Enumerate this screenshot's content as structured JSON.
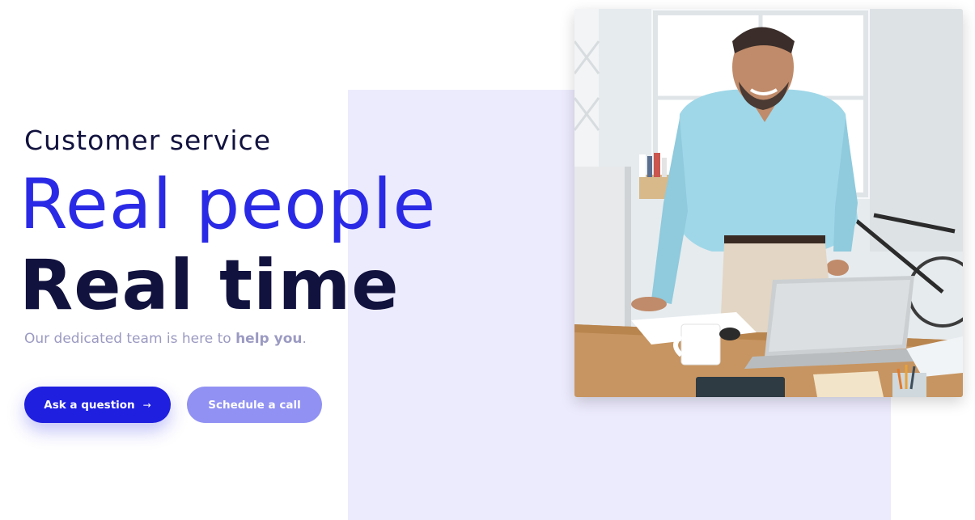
{
  "hero": {
    "eyebrow": "Customer service",
    "headline_line_1": "Real people",
    "headline_line_2": "Real time",
    "subtitle_prefix": "Our dedicated team is here to ",
    "subtitle_emphasis": "help you",
    "subtitle_suffix": "."
  },
  "buttons": {
    "primary_label": "Ask a question",
    "primary_icon": "arrow-right-icon",
    "secondary_label": "Schedule a call"
  },
  "photo": {
    "subject": "smiling man in light blue shirt leaning on desk with laptop"
  },
  "colors": {
    "accent_blue": "#2a2ae6",
    "dark_navy": "#12123f",
    "muted_text": "#9b9ac2",
    "panel_lavender": "#ecebfd",
    "primary_button": "#1f1fe0",
    "secondary_button": "#9191f3"
  }
}
